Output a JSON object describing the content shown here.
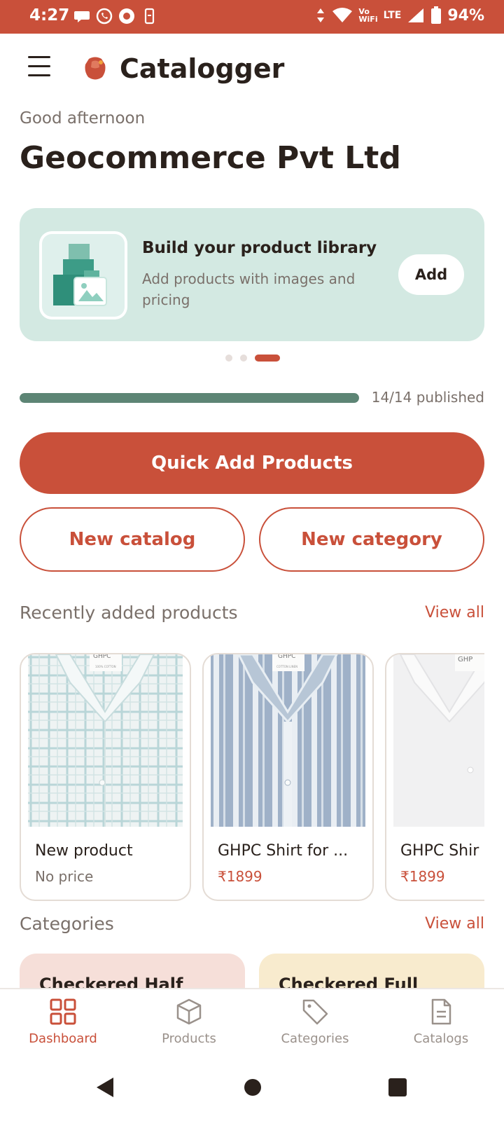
{
  "status_bar": {
    "time": "4:27",
    "network_vo": "Vo",
    "network_wifi": "WiFi",
    "network_lte": "LTE",
    "battery": "94%"
  },
  "header": {
    "app_name": "Catalogger"
  },
  "greeting": "Good afternoon",
  "company_name": "Geocommerce Pvt Ltd",
  "promo": {
    "title": "Build your product library",
    "subtitle": "Add products with images and pricing",
    "button_label": "Add",
    "carousel_total": 3,
    "carousel_active": 3
  },
  "progress": {
    "published": 14,
    "total": 14,
    "label": "14/14 published"
  },
  "actions": {
    "quick_add": "Quick Add Products",
    "new_catalog": "New catalog",
    "new_category": "New category"
  },
  "recent_products": {
    "title": "Recently added products",
    "view_all": "View all",
    "items": [
      {
        "name": "New product",
        "price": "No price"
      },
      {
        "name": "GHPC Shirt for ...",
        "price": "₹1899"
      },
      {
        "name": "GHPC Shir",
        "price": "₹1899"
      }
    ]
  },
  "categories": {
    "title": "Categories",
    "view_all": "View all",
    "items": [
      {
        "name": "Checkered Half"
      },
      {
        "name": "Checkered Full"
      }
    ]
  },
  "bottom_nav": [
    {
      "label": "Dashboard",
      "icon": "dashboard-grid-icon",
      "active": true
    },
    {
      "label": "Products",
      "icon": "box-icon",
      "active": false
    },
    {
      "label": "Categories",
      "icon": "tag-icon",
      "active": false
    },
    {
      "label": "Catalogs",
      "icon": "document-icon",
      "active": false
    }
  ],
  "colors": {
    "brand": "#c9503a",
    "progress": "#5d8575",
    "promo_bg": "#d3e9e2"
  }
}
